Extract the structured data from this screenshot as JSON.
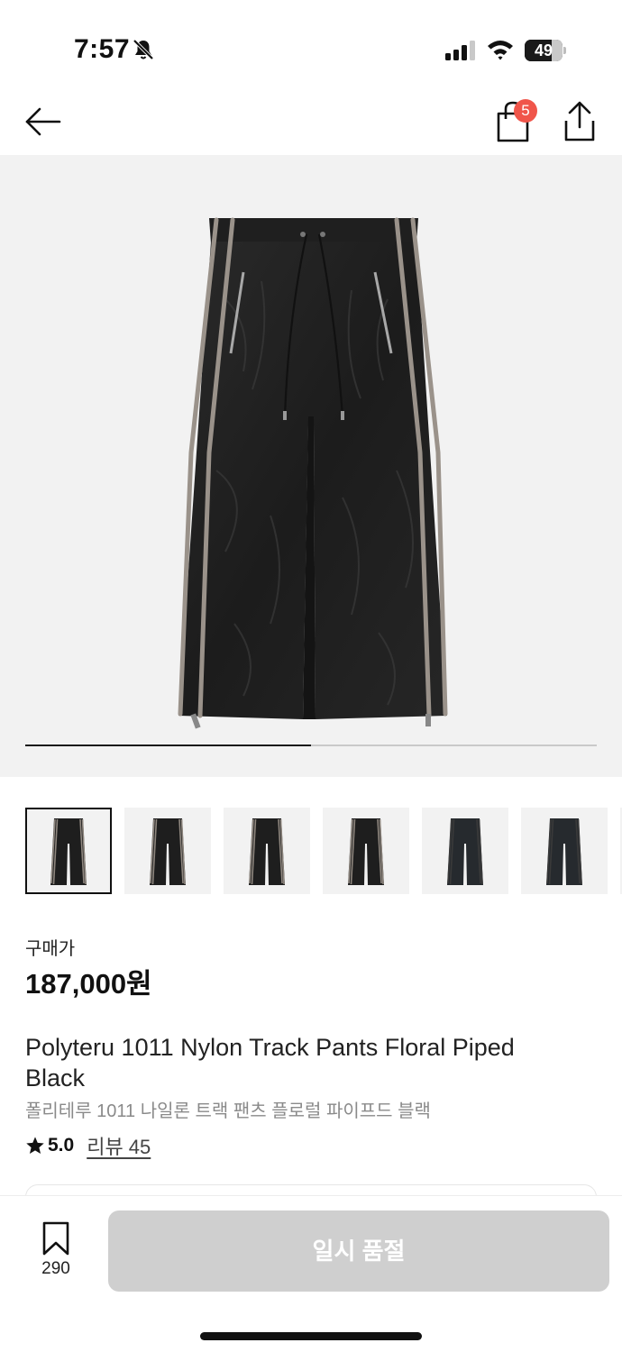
{
  "status_bar": {
    "time": "7:57",
    "battery": "49",
    "battery_level": 0.49,
    "icons": [
      "bell-off-icon",
      "cellular-signal-icon",
      "wifi-icon",
      "battery-icon"
    ]
  },
  "nav": {
    "icons": [
      "back-arrow-icon",
      "shopping-bag-icon",
      "share-icon"
    ],
    "cart_badge": "5"
  },
  "gallery": {
    "image_count": 2,
    "progress": 0.5,
    "thumbnail_count": 6,
    "selected_index": 0
  },
  "product": {
    "price_label": "구매가",
    "price": "187,000원",
    "title_en": "Polyteru 1011 Nylon Track Pants Floral Piped Black",
    "title_ko": "폴리테루 1011 나일론 트랙 팬츠 플로럴 파이프드 블랙",
    "rating": "5.0",
    "review_label": "리뷰 45"
  },
  "bottom_bar": {
    "wish_count": "290",
    "buy_label": "일시 품절"
  },
  "colors": {
    "badge": "#f0554a",
    "disabled_button": "#cfcfcf",
    "image_background": "#f2f2f2"
  }
}
